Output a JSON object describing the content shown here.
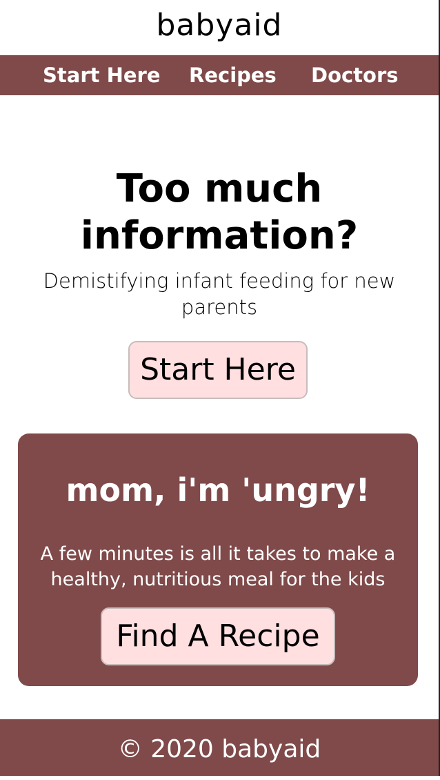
{
  "header": {
    "logo": "babyaid"
  },
  "nav": {
    "items": [
      {
        "label": "Start Here"
      },
      {
        "label": "Recipes"
      },
      {
        "label": "Doctors"
      }
    ]
  },
  "hero": {
    "title": "Too much information?",
    "subtitle": "Demistifying infant feeding for new parents",
    "button_label": "Start Here"
  },
  "card": {
    "title": "mom, i'm 'ungry!",
    "text": "A few minutes is all it takes to make a healthy, nutritious meal for the kids",
    "button_label": "Find A Recipe"
  },
  "footer": {
    "text": "© 2020 babyaid"
  },
  "colors": {
    "brand": "#804a4a",
    "button_bg": "#ffdfdf"
  }
}
